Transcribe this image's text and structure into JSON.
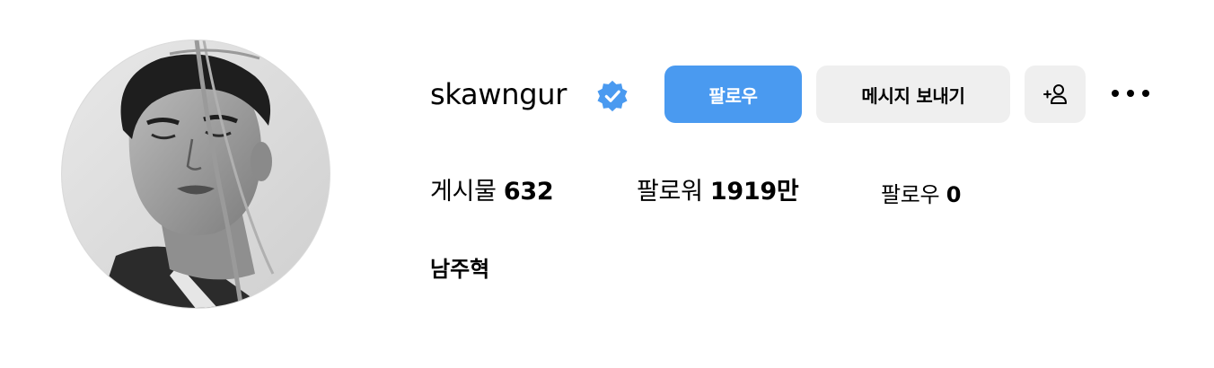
{
  "profile": {
    "username": "skawngur",
    "full_name": "남주혁",
    "verified": true,
    "avatar_alt": "profile-photo"
  },
  "actions": {
    "follow_label": "팔로우",
    "message_label": "메시지 보내기",
    "add_user_icon": "person-add-icon",
    "more_icon": "more-horizontal-icon"
  },
  "stats": {
    "posts_label": "게시물",
    "posts_count": "632",
    "followers_label": "팔로워",
    "followers_count": "1919만",
    "following_label": "팔로우",
    "following_count": "0"
  },
  "colors": {
    "follow_button": "#4a9af0",
    "secondary_button": "#efefef",
    "verified_badge": "#4a9af0"
  }
}
